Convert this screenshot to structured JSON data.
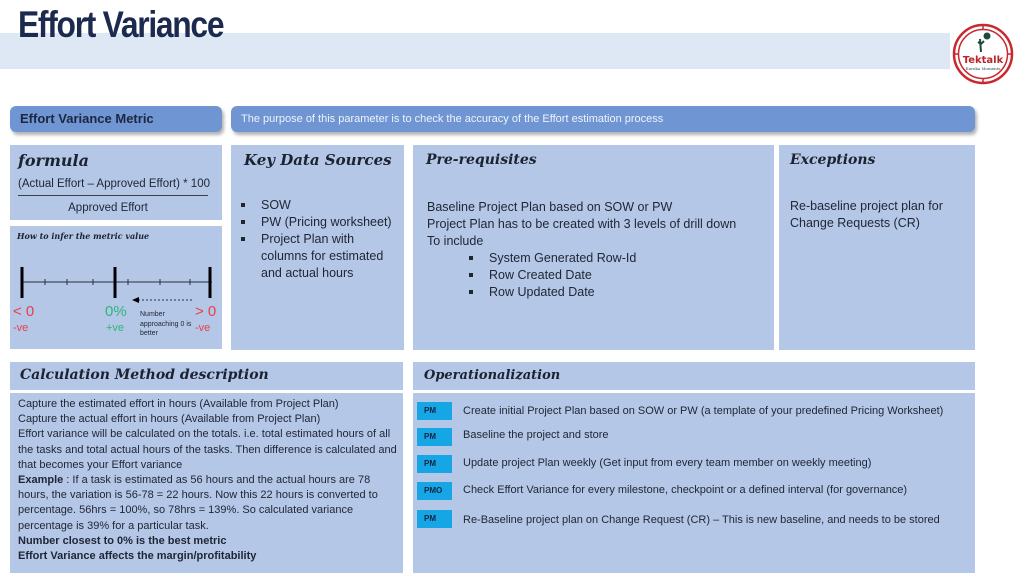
{
  "page": {
    "title": "Effort Variance",
    "logo": {
      "name": "Tektalk",
      "tagline": "Eureka Moments"
    }
  },
  "header": {
    "metric_label": "Effort Variance Metric",
    "purpose": "The purpose of this parameter is to check the accuracy of the Effort estimation process"
  },
  "formula": {
    "heading": "formula",
    "numerator": "(Actual Effort – Approved Effort) * 100",
    "denominator": "Approved Effort"
  },
  "infer": {
    "heading": "How to infer the metric value",
    "left_value": "< 0",
    "left_sign": "-ve",
    "center_value": "0%",
    "center_sign": "+ve",
    "right_value": "> 0",
    "right_sign": "-ve",
    "note": [
      "Number",
      "approaching 0 is",
      "better"
    ],
    "colors": {
      "negative": "#e8404a",
      "zero": "#2fb67c"
    }
  },
  "key_data_sources": {
    "heading": "Key Data Sources",
    "items": [
      "SOW",
      "PW (Pricing worksheet)",
      "Project Plan with columns for estimated and actual hours"
    ]
  },
  "prerequisites": {
    "heading": "Pre-requisites",
    "lines": [
      "Baseline Project Plan based on SOW or PW",
      "Project Plan has to be created with 3 levels of drill down",
      "To include"
    ],
    "items": [
      "System Generated Row-Id",
      "Row Created Date",
      "Row Updated Date"
    ]
  },
  "exceptions": {
    "heading": "Exceptions",
    "text": "Re-baseline project plan for Change Requests (CR)"
  },
  "calculation": {
    "heading": "Calculation Method description",
    "lines": [
      "Capture the estimated effort in hours (Available from Project Plan)",
      "Capture the actual effort in hours (Available from Project Plan)",
      "Effort  variance will be calculated on the totals. i.e. total estimated hours of all the tasks and total actual hours of the tasks. Then difference is calculated and that becomes your Effort variance"
    ],
    "example_label": "Example",
    "example_text": " : If a task is estimated as 56 hours and the actual hours are 78 hours, the variation is 56-78 = 22 hours. Now this 22 hours is converted to percentage.  56hrs = 100%, so 78hrs = 139%. So calculated variance percentage is 39% for a particular task.",
    "bold_lines": [
      "Number closest to 0% is the best metric",
      "Effort Variance affects the margin/profitability"
    ]
  },
  "operationalization": {
    "heading": "Operationalization",
    "steps": [
      {
        "role": "PM",
        "text": "Create initial Project Plan based on SOW or PW (a template of your predefined Pricing Worksheet)"
      },
      {
        "role": "PM",
        "text": "Baseline the project and store"
      },
      {
        "role": "PM",
        "text": "Update project Plan weekly (Get input from every team member on weekly meeting)"
      },
      {
        "role": "PMO",
        "text": "Check Effort Variance for every milestone, checkpoint or a defined interval (for governance)"
      },
      {
        "role": "PM",
        "text": "Re-Baseline project plan on Change Request (CR) – This is new baseline, and needs to be stored"
      }
    ],
    "badge_color": "#16a6e6"
  }
}
